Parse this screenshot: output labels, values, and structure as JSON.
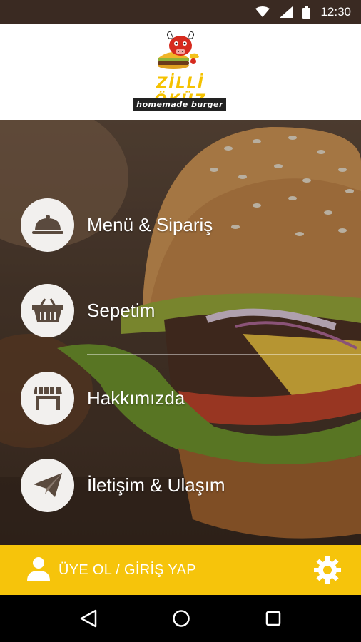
{
  "status_bar": {
    "time": "12:30",
    "icons": [
      "wifi-icon",
      "signal-icon",
      "battery-icon"
    ]
  },
  "header": {
    "brand": "ZİLLİ ÖKÜZ",
    "tagline": "homemade burger"
  },
  "menu": [
    {
      "label": "Menü & Sipariş",
      "icon": "cloche-icon"
    },
    {
      "label": "Sepetim",
      "icon": "basket-icon"
    },
    {
      "label": "Hakkımızda",
      "icon": "store-icon"
    },
    {
      "label": "İletişim & Ulaşım",
      "icon": "paper-plane-icon"
    }
  ],
  "bottom_bar": {
    "login_label": "ÜYE OL / GİRİŞ YAP",
    "icons": [
      "user-icon",
      "gear-icon"
    ]
  },
  "nav": {
    "icons": [
      "back-icon",
      "home-icon",
      "recents-icon"
    ]
  },
  "colors": {
    "accent": "#F6C40B",
    "status_bar": "#3A2A22",
    "circle": "#F2F0EE",
    "icon": "#5A4A3E"
  }
}
